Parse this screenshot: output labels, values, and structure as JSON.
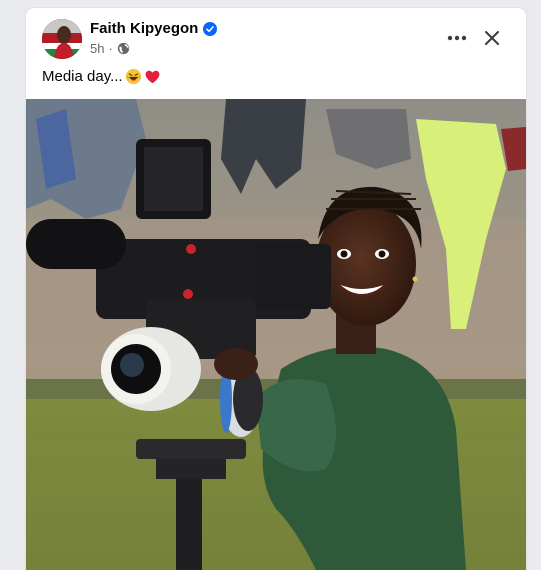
{
  "post": {
    "author": "Faith Kipyegon",
    "time": "5h",
    "separator": "·",
    "caption": "Media day...",
    "visibility_icon": "globe-icon",
    "verified_icon": "verified-badge-icon",
    "menu_icon": "more-horizontal-icon",
    "close_icon": "close-icon",
    "emojis": [
      "laughing-emoji",
      "red-heart-emoji"
    ]
  },
  "colors": {
    "verified": "#0866ff",
    "text_primary": "#050505",
    "text_secondary": "#65676b",
    "heart": "#e41e3f"
  }
}
